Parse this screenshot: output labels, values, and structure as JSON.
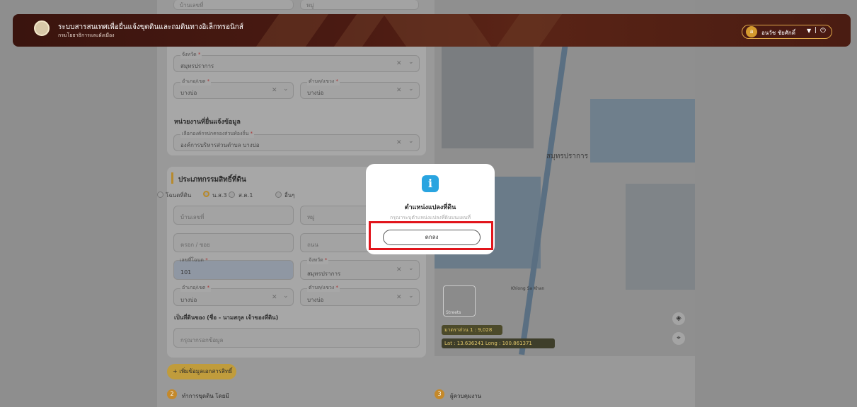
{
  "header": {
    "title": "ระบบสารสนเทศเพื่อยื่นแจ้งขุดดินและถมดินทางอิเล็กทรอนิกส์",
    "subtitle": "กรมโยธาธิการและผังเมือง",
    "user_initial": "อ",
    "user_name": "อนวัช ชัยศักดิ์",
    "caret": "▼",
    "separator": "|",
    "power_icon": "⏻"
  },
  "top_fields": {
    "house_no_placeholder": "บ้านเลขที่",
    "moo_placeholder": "หมู่",
    "province_label": "จังหวัด",
    "province_value": "สมุทรปราการ",
    "district_label": "อำเภอ/เขต",
    "district_value": "บางบ่อ",
    "subdistrict_label": "ตำบล/แขวง",
    "subdistrict_value": "บางบ่อ",
    "clear_icon": "✕",
    "chevron_icon": "⌄"
  },
  "agency": {
    "section_title": "หน่วยงานที่ยื่นแจ้งข้อมูล",
    "label": "เลือกองค์กรปกครองส่วนท้องถิ่น",
    "value": "องค์การบริหารส่วนตำบล บางบ่อ"
  },
  "land_rights": {
    "section_title": "ประเภทกรรมสิทธิ์ที่ดิน",
    "options": [
      "โฉนดที่ดิน",
      "น.ส.3 ก",
      "ส.ค.1",
      "อื่นๆ"
    ],
    "selected_index": 1,
    "house_no_placeholder": "บ้านเลขที่",
    "moo_placeholder": "หมู่",
    "soi_placeholder": "ตรอก / ซอย",
    "road_placeholder": "ถนน",
    "deed_no_label": "เลขที่โฉนด",
    "deed_no_value": "101",
    "province_label": "จังหวัด",
    "province_value": "สมุทรปราการ",
    "district_label": "อำเภอ/เขต",
    "district_value": "บางบ่อ",
    "subdistrict_label": "ตำบล/แขวง",
    "subdistrict_value": "บางบ่อ",
    "owner_label": "เป็นที่ดินของ (ชื่อ - นามสกุล เจ้าของที่ดิน)",
    "owner_placeholder": "กรุณากรอกข้อมูล",
    "required_mark": "*"
  },
  "map": {
    "province_label": "สมุทรปราการ",
    "place_label": "Khlong Sa Khan",
    "thumb_label": "Streets",
    "scale_label": "มาตราส่วน 1 : 9,028",
    "coords_label": "Lat : 13.636241   Long : 100.861371",
    "layers_icon": "◈",
    "compass_icon": "⌖"
  },
  "bottom": {
    "add_button": "+ เพิ่มข้อมูลเอกสารสิทธิ์",
    "step2_num": "2",
    "step2_label": "ทำการขุดดิน โดยมี",
    "step3_num": "3",
    "step3_label": "ผู้ควบคุมงาน"
  },
  "modal": {
    "icon": "i",
    "title": "ตำแหน่งแปลงที่ดิน",
    "message": "กรุณาระบุตำแหน่งแปลงที่ดินบนแผนที่",
    "ok_button": "ตกลง"
  },
  "colors": {
    "highlight": "#e1141b",
    "accent": "#d49a2e",
    "info_icon": "#29a4e0"
  }
}
